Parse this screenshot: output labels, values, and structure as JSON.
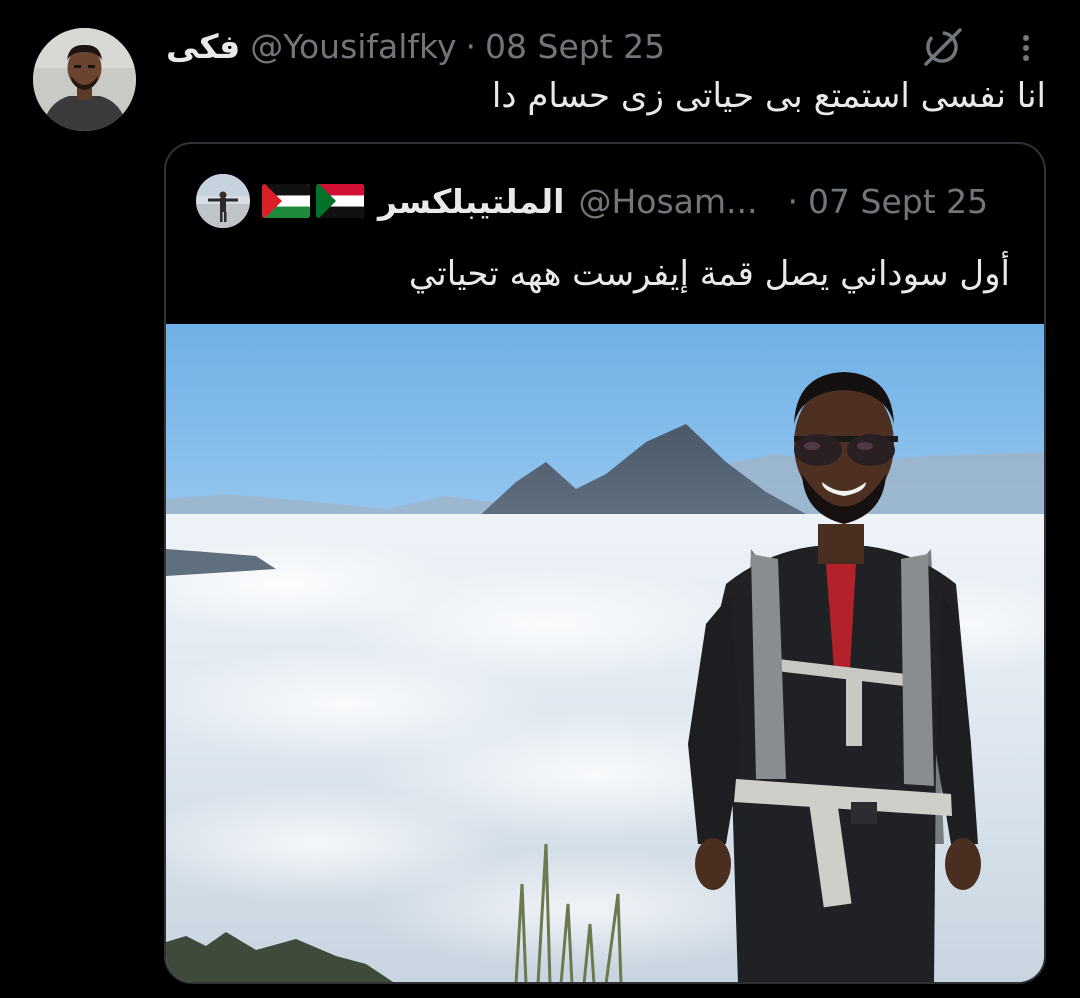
{
  "tweet": {
    "display_name": "فكى",
    "handle": "@Yousifalfky",
    "separator": "·",
    "date": "08 Sept 25",
    "text": "انا نفسى استمتع بى حياتى زى حسام دا"
  },
  "quoted_tweet": {
    "display_name": "الملتيبلكسر",
    "handle": "@Hosam...",
    "separator": "·",
    "date": "07 Sept 25",
    "text": "أول سوداني يصل قمة إيفرست ههه تحياتي",
    "flags": [
      "palestine-flag",
      "sudan-flag"
    ],
    "photo_alt": "hiker-above-clouds-photo"
  },
  "icons": {
    "grok": "grok-icon",
    "more": "more-icon"
  },
  "colors": {
    "background": "#000000",
    "primary_text": "#e7e9ea",
    "secondary_text": "#71767b",
    "card_border": "#2f3336"
  }
}
